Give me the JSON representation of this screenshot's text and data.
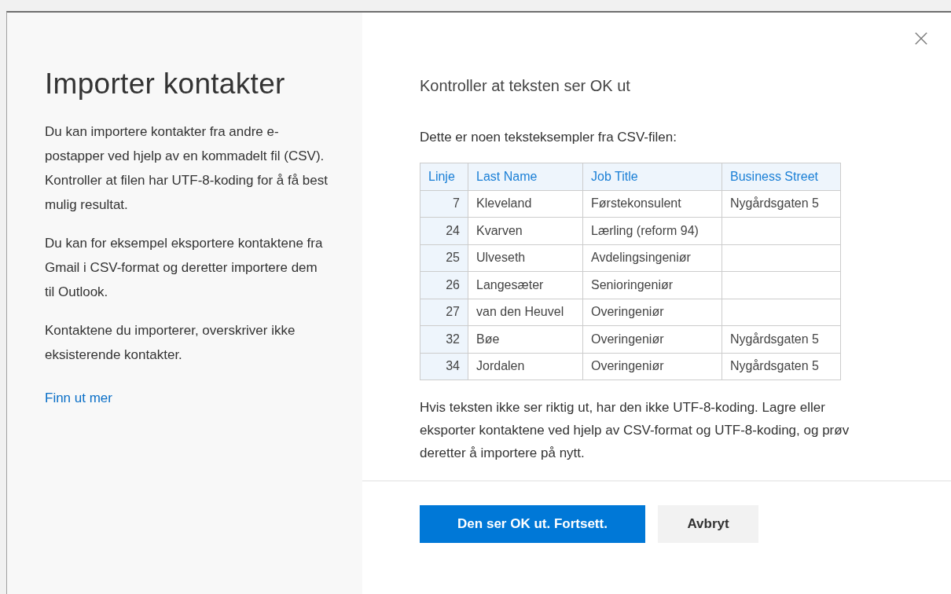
{
  "sidebar": {
    "title": "Importer kontakter",
    "paragraphs": [
      "Du kan importere kontakter fra andre e-postapper ved hjelp av en kommadelt fil (CSV). Kontroller at filen har UTF-8-koding for å få best mulig resultat.",
      "Du kan for eksempel eksportere kontaktene fra Gmail i CSV-format og deretter importere dem til Outlook.",
      "Kontaktene du importerer, overskriver ikke eksisterende kontakter."
    ],
    "link": "Finn ut mer"
  },
  "main": {
    "heading": "Kontroller at teksten ser OK ut",
    "intro": "Dette er noen teksteksempler fra CSV-filen:",
    "table": {
      "columns": [
        "Linje",
        "Last Name",
        "Job Title",
        "Business Street"
      ],
      "rows": [
        [
          "7",
          "Kleveland",
          "Førstekonsulent",
          "Nygårdsgaten 5"
        ],
        [
          "24",
          "Kvarven",
          "Lærling (reform 94)",
          ""
        ],
        [
          "25",
          "Ulveseth",
          "Avdelingsingeniør",
          ""
        ],
        [
          "26",
          "Langesæter",
          "Senioringeniør",
          ""
        ],
        [
          "27",
          "van den Heuvel",
          "Overingeniør",
          ""
        ],
        [
          "32",
          "Bøe",
          "Overingeniør",
          "Nygårdsgaten 5"
        ],
        [
          "34",
          "Jordalen",
          "Overingeniør",
          "Nygårdsgaten 5"
        ]
      ]
    },
    "note": "Hvis teksten ikke ser riktig ut, har den ikke UTF-8-koding. Lagre eller eksporter kontaktene ved hjelp av CSV-format og UTF-8-koding, og prøv deretter å importere på nytt."
  },
  "buttons": [
    {
      "label": "Den ser OK ut. Fortsett.",
      "kind": "primary"
    },
    {
      "label": "Avbryt",
      "kind": "secondary"
    }
  ]
}
